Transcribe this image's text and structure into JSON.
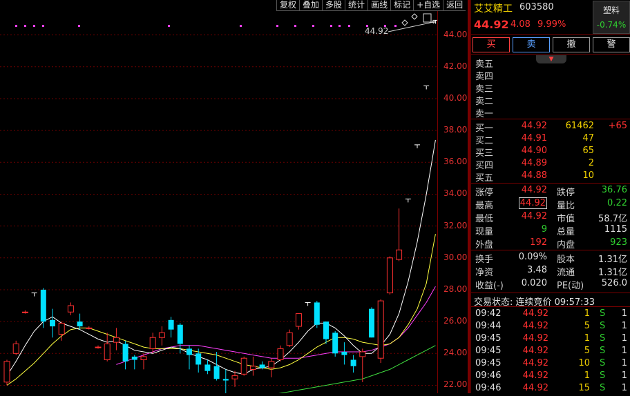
{
  "toolbar": [
    "复权",
    "叠加",
    "多股",
    "统计",
    "画线",
    "标记",
    "+自选",
    "返回"
  ],
  "chart": {
    "ymin": 21.5,
    "ymax": 45.5,
    "yticks": [
      "44.00",
      "42.00",
      "40.00",
      "38.00",
      "36.00",
      "34.00",
      "32.00",
      "30.00",
      "28.00",
      "26.00",
      "24.00",
      "22.00"
    ],
    "price_tag": "44.92",
    "colors": {
      "up": "#ff3030",
      "down": "#00e0ff",
      "ma5": "#ffffff",
      "ma10": "#ffff40",
      "ma20": "#ff40ff",
      "ma60": "#40e040",
      "grid": "#6a0000"
    }
  },
  "chart_data": {
    "type": "candlestick",
    "candles": [
      {
        "o": 22.2,
        "h": 23.6,
        "l": 22.0,
        "c": 23.5
      },
      {
        "o": 24.0,
        "h": 24.8,
        "l": 23.9,
        "c": 24.6
      },
      {
        "o": 26.6,
        "h": 26.7,
        "l": 26.5,
        "c": 26.6
      },
      {
        "o": 27.8,
        "h": 27.8,
        "l": 27.8,
        "c": 27.8
      },
      {
        "o": 28.0,
        "h": 28.1,
        "l": 25.6,
        "c": 26.0
      },
      {
        "o": 26.1,
        "h": 26.8,
        "l": 25.0,
        "c": 25.7
      },
      {
        "o": 25.2,
        "h": 26.0,
        "l": 24.8,
        "c": 25.9
      },
      {
        "o": 26.6,
        "h": 27.2,
        "l": 26.4,
        "c": 27.0
      },
      {
        "o": 26.0,
        "h": 26.5,
        "l": 25.5,
        "c": 25.7
      },
      {
        "o": 25.6,
        "h": 25.7,
        "l": 25.5,
        "c": 25.6
      },
      {
        "o": 24.4,
        "h": 24.5,
        "l": 24.3,
        "c": 24.4
      },
      {
        "o": 23.6,
        "h": 25.3,
        "l": 23.5,
        "c": 24.6
      },
      {
        "o": 24.7,
        "h": 25.6,
        "l": 24.2,
        "c": 25.0
      },
      {
        "o": 24.6,
        "h": 24.8,
        "l": 23.0,
        "c": 23.5
      },
      {
        "o": 23.8,
        "h": 23.9,
        "l": 23.0,
        "c": 23.6
      },
      {
        "o": 23.6,
        "h": 24.0,
        "l": 23.0,
        "c": 23.8
      },
      {
        "o": 24.3,
        "h": 25.3,
        "l": 24.0,
        "c": 25.0
      },
      {
        "o": 25.0,
        "h": 25.7,
        "l": 24.5,
        "c": 25.3
      },
      {
        "o": 26.1,
        "h": 26.3,
        "l": 25.0,
        "c": 25.5
      },
      {
        "o": 25.8,
        "h": 25.9,
        "l": 24.0,
        "c": 24.6
      },
      {
        "o": 24.3,
        "h": 24.5,
        "l": 23.0,
        "c": 23.9
      },
      {
        "o": 24.0,
        "h": 24.3,
        "l": 22.8,
        "c": 23.3
      },
      {
        "o": 23.3,
        "h": 23.6,
        "l": 22.7,
        "c": 22.9
      },
      {
        "o": 23.2,
        "h": 24.1,
        "l": 22.3,
        "c": 22.4
      },
      {
        "o": 22.4,
        "h": 23.0,
        "l": 21.4,
        "c": 22.3
      },
      {
        "o": 22.4,
        "h": 22.9,
        "l": 21.9,
        "c": 22.6
      },
      {
        "o": 22.7,
        "h": 23.8,
        "l": 22.6,
        "c": 23.7
      },
      {
        "o": 23.0,
        "h": 23.8,
        "l": 22.6,
        "c": 23.2
      },
      {
        "o": 23.3,
        "h": 23.5,
        "l": 23.0,
        "c": 23.1
      },
      {
        "o": 23.1,
        "h": 23.7,
        "l": 22.5,
        "c": 23.5
      },
      {
        "o": 23.6,
        "h": 24.5,
        "l": 23.5,
        "c": 24.3
      },
      {
        "o": 24.5,
        "h": 25.5,
        "l": 24.4,
        "c": 25.3
      },
      {
        "o": 25.7,
        "h": 26.5,
        "l": 25.5,
        "c": 26.5
      },
      {
        "o": 27.2,
        "h": 27.2,
        "l": 27.2,
        "c": 27.2
      },
      {
        "o": 27.2,
        "h": 27.3,
        "l": 25.6,
        "c": 25.8
      },
      {
        "o": 26.0,
        "h": 26.0,
        "l": 24.6,
        "c": 24.9
      },
      {
        "o": 25.3,
        "h": 25.4,
        "l": 23.8,
        "c": 24.0
      },
      {
        "o": 24.1,
        "h": 24.7,
        "l": 23.3,
        "c": 23.9
      },
      {
        "o": 23.6,
        "h": 23.9,
        "l": 22.8,
        "c": 23.2
      },
      {
        "o": 23.8,
        "h": 24.3,
        "l": 22.2,
        "c": 24.1
      },
      {
        "o": 26.8,
        "h": 26.9,
        "l": 25.0,
        "c": 25.0
      },
      {
        "o": 23.7,
        "h": 27.4,
        "l": 23.4,
        "c": 27.3
      },
      {
        "o": 27.8,
        "h": 30.1,
        "l": 27.7,
        "c": 30.0
      },
      {
        "o": 29.9,
        "h": 33.1,
        "l": 29.8,
        "c": 30.5
      },
      {
        "o": 33.7,
        "h": 33.7,
        "l": 33.7,
        "c": 33.7
      },
      {
        "o": 37.1,
        "h": 37.1,
        "l": 37.1,
        "c": 37.1
      },
      {
        "o": 40.8,
        "h": 40.8,
        "l": 40.8,
        "c": 40.8
      },
      {
        "o": 44.92,
        "h": 44.92,
        "l": 44.92,
        "c": 44.92
      }
    ],
    "ma5": [
      22.6,
      23.5,
      24.5,
      25.4,
      26.0,
      26.3,
      25.9,
      25.7,
      25.5,
      25.2,
      24.9,
      24.7,
      24.8,
      24.5,
      24.2,
      24.1,
      24.0,
      24.2,
      24.4,
      24.3,
      24.0,
      23.8,
      23.6,
      23.3,
      23.0,
      22.8,
      22.7,
      23.0,
      23.1,
      23.2,
      23.6,
      24.1,
      24.7,
      25.4,
      25.9,
      25.9,
      25.6,
      25.1,
      24.5,
      24.0,
      24.0,
      24.5,
      25.2,
      26.5,
      28.5,
      31.0,
      34.0,
      37.4
    ],
    "ma10": [
      22.0,
      22.4,
      22.9,
      23.4,
      24.0,
      24.6,
      25.1,
      25.5,
      25.6,
      25.6,
      25.4,
      25.2,
      25.0,
      24.8,
      24.6,
      24.4,
      24.3,
      24.3,
      24.3,
      24.3,
      24.2,
      24.1,
      24.0,
      23.9,
      23.7,
      23.5,
      23.3,
      23.2,
      23.1,
      23.0,
      23.1,
      23.3,
      23.6,
      24.0,
      24.4,
      24.7,
      25.0,
      25.0,
      24.9,
      24.7,
      24.6,
      24.5,
      24.6,
      25.0,
      25.8,
      26.8,
      28.4,
      31.5
    ],
    "ma20": [
      null,
      null,
      null,
      null,
      null,
      null,
      null,
      null,
      null,
      null,
      null,
      null,
      23.3,
      23.5,
      23.7,
      23.9,
      24.1,
      24.3,
      24.4,
      24.5,
      24.5,
      24.5,
      24.4,
      24.3,
      24.2,
      24.1,
      24.0,
      23.9,
      23.8,
      23.7,
      23.7,
      23.7,
      23.7,
      23.8,
      23.9,
      24.0,
      24.1,
      24.1,
      24.1,
      24.1,
      24.2,
      24.4,
      24.6,
      25.0,
      25.6,
      26.4,
      27.2,
      28.2
    ],
    "ma60": [
      null,
      null,
      null,
      null,
      null,
      null,
      null,
      null,
      null,
      null,
      null,
      null,
      null,
      null,
      null,
      null,
      null,
      null,
      null,
      null,
      null,
      null,
      null,
      null,
      null,
      null,
      null,
      21.0,
      21.2,
      21.4,
      21.5,
      21.6,
      21.7,
      21.8,
      21.9,
      22.0,
      22.1,
      22.2,
      22.3,
      22.4,
      22.6,
      22.8,
      23.0,
      23.3,
      23.6,
      23.9,
      24.2,
      24.5
    ]
  },
  "panel": {
    "name": "艾艾精工",
    "code": "603580",
    "price": "44.92",
    "change": "4.08",
    "pct": "9.99%",
    "sector": "塑料",
    "sector_pct": "-0.74%",
    "buttons": [
      "买",
      "卖",
      "撤",
      "警"
    ],
    "asks": [
      {
        "label": "卖五",
        "price": "",
        "vol": ""
      },
      {
        "label": "卖四",
        "price": "",
        "vol": ""
      },
      {
        "label": "卖三",
        "price": "",
        "vol": ""
      },
      {
        "label": "卖二",
        "price": "",
        "vol": ""
      },
      {
        "label": "卖一",
        "price": "",
        "vol": ""
      }
    ],
    "bids": [
      {
        "label": "买一",
        "price": "44.92",
        "vol": "61462",
        "extra": "+65"
      },
      {
        "label": "买二",
        "price": "44.91",
        "vol": "47",
        "extra": ""
      },
      {
        "label": "买三",
        "price": "44.90",
        "vol": "65",
        "extra": ""
      },
      {
        "label": "买四",
        "price": "44.89",
        "vol": "2",
        "extra": ""
      },
      {
        "label": "买五",
        "price": "44.88",
        "vol": "10",
        "extra": ""
      }
    ],
    "stats": [
      {
        "l1": "涨停",
        "v1": "44.92",
        "c1": "red",
        "l2": "跌停",
        "v2": "36.76",
        "c2": "green"
      },
      {
        "l1": "最高",
        "v1": "44.92",
        "c1": "red boxed",
        "l2": "量比",
        "v2": "0.22",
        "c2": "green"
      },
      {
        "l1": "最低",
        "v1": "44.92",
        "c1": "red",
        "l2": "市值",
        "v2": "58.7亿",
        "c2": "white"
      },
      {
        "l1": "现量",
        "v1": "9",
        "c1": "green",
        "l2": "总量",
        "v2": "1115",
        "c2": "white"
      },
      {
        "l1": "外盘",
        "v1": "192",
        "c1": "red",
        "l2": "内盘",
        "v2": "923",
        "c2": "green"
      }
    ],
    "stats2": [
      {
        "l1": "换手",
        "v1": "0.09%",
        "c1": "white",
        "l2": "股本",
        "v2": "1.31亿",
        "c2": "white"
      },
      {
        "l1": "净资",
        "v1": "3.48",
        "c1": "white",
        "l2": "流通",
        "v2": "1.31亿",
        "c2": "white"
      },
      {
        "l1": "收益(-)",
        "v1": "0.020",
        "c1": "white",
        "l2": "PE(动)",
        "v2": "526.0",
        "c2": "white"
      }
    ],
    "trade_status": "交易状态: 连续竞价 09:57:33",
    "trades": [
      {
        "t": "09:42",
        "p": "44.92",
        "v": "1",
        "s": "S",
        "n": "1"
      },
      {
        "t": "09:44",
        "p": "44.92",
        "v": "5",
        "s": "S",
        "n": "1"
      },
      {
        "t": "09:45",
        "p": "44.92",
        "v": "1",
        "s": "S",
        "n": "1"
      },
      {
        "t": "09:45",
        "p": "44.92",
        "v": "5",
        "s": "S",
        "n": "1"
      },
      {
        "t": "09:45",
        "p": "44.92",
        "v": "10",
        "s": "S",
        "n": "1"
      },
      {
        "t": "09:46",
        "p": "44.92",
        "v": "1",
        "s": "S",
        "n": "1"
      },
      {
        "t": "09:46",
        "p": "44.92",
        "v": "15",
        "s": "S",
        "n": "1"
      }
    ]
  }
}
